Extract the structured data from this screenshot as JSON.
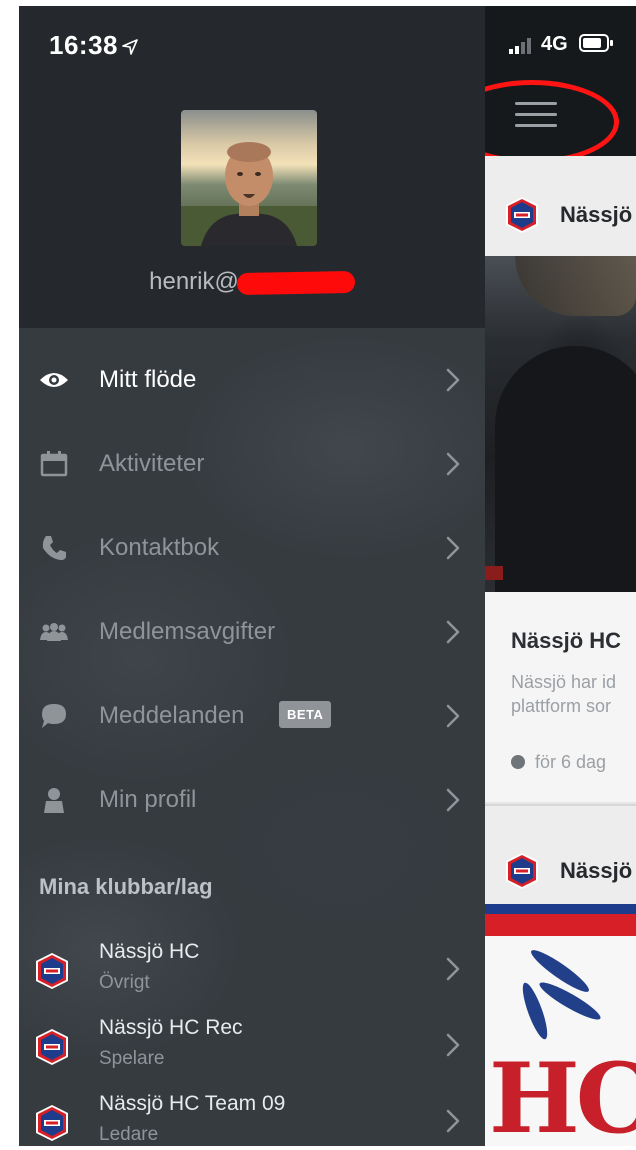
{
  "status_bar": {
    "time": "16:38",
    "network": "4G"
  },
  "profile": {
    "email_visible": "henrik@",
    "email_redacted": true
  },
  "menu": {
    "items": [
      {
        "label": "Mitt flöde",
        "icon": "eye-icon",
        "active": true
      },
      {
        "label": "Aktiviteter",
        "icon": "calendar-icon",
        "active": false
      },
      {
        "label": "Kontaktbok",
        "icon": "phone-icon",
        "active": false
      },
      {
        "label": "Medlemsavgifter",
        "icon": "members-icon",
        "active": false
      },
      {
        "label": "Meddelanden",
        "icon": "chat-bubble-icon",
        "active": false,
        "badge": "BETA"
      },
      {
        "label": "Min profil",
        "icon": "person-icon",
        "active": false
      }
    ]
  },
  "clubs": {
    "heading": "Mina klubbar/lag",
    "items": [
      {
        "name": "Nässjö HC",
        "role": "Övrigt"
      },
      {
        "name": "Nässjö HC Rec",
        "role": "Spelare"
      },
      {
        "name": "Nässjö HC Team 09",
        "role": "Ledare"
      }
    ]
  },
  "feed": {
    "post1": {
      "author": "Nässjö",
      "title": "Nässjö HC",
      "excerpt_line1": "Nässjö har id",
      "excerpt_line2": "plattform sor",
      "time": "för 6 dag"
    },
    "post2": {
      "author": "Nässjö",
      "photo_text": "HC"
    }
  },
  "colors": {
    "drawer_bg": "#26292d",
    "menu_text": "#8f9499",
    "menu_text_active": "#ffffff",
    "annotation_red": "#ff1414",
    "club_blue": "#1e3c8c",
    "club_red": "#d61f26"
  }
}
